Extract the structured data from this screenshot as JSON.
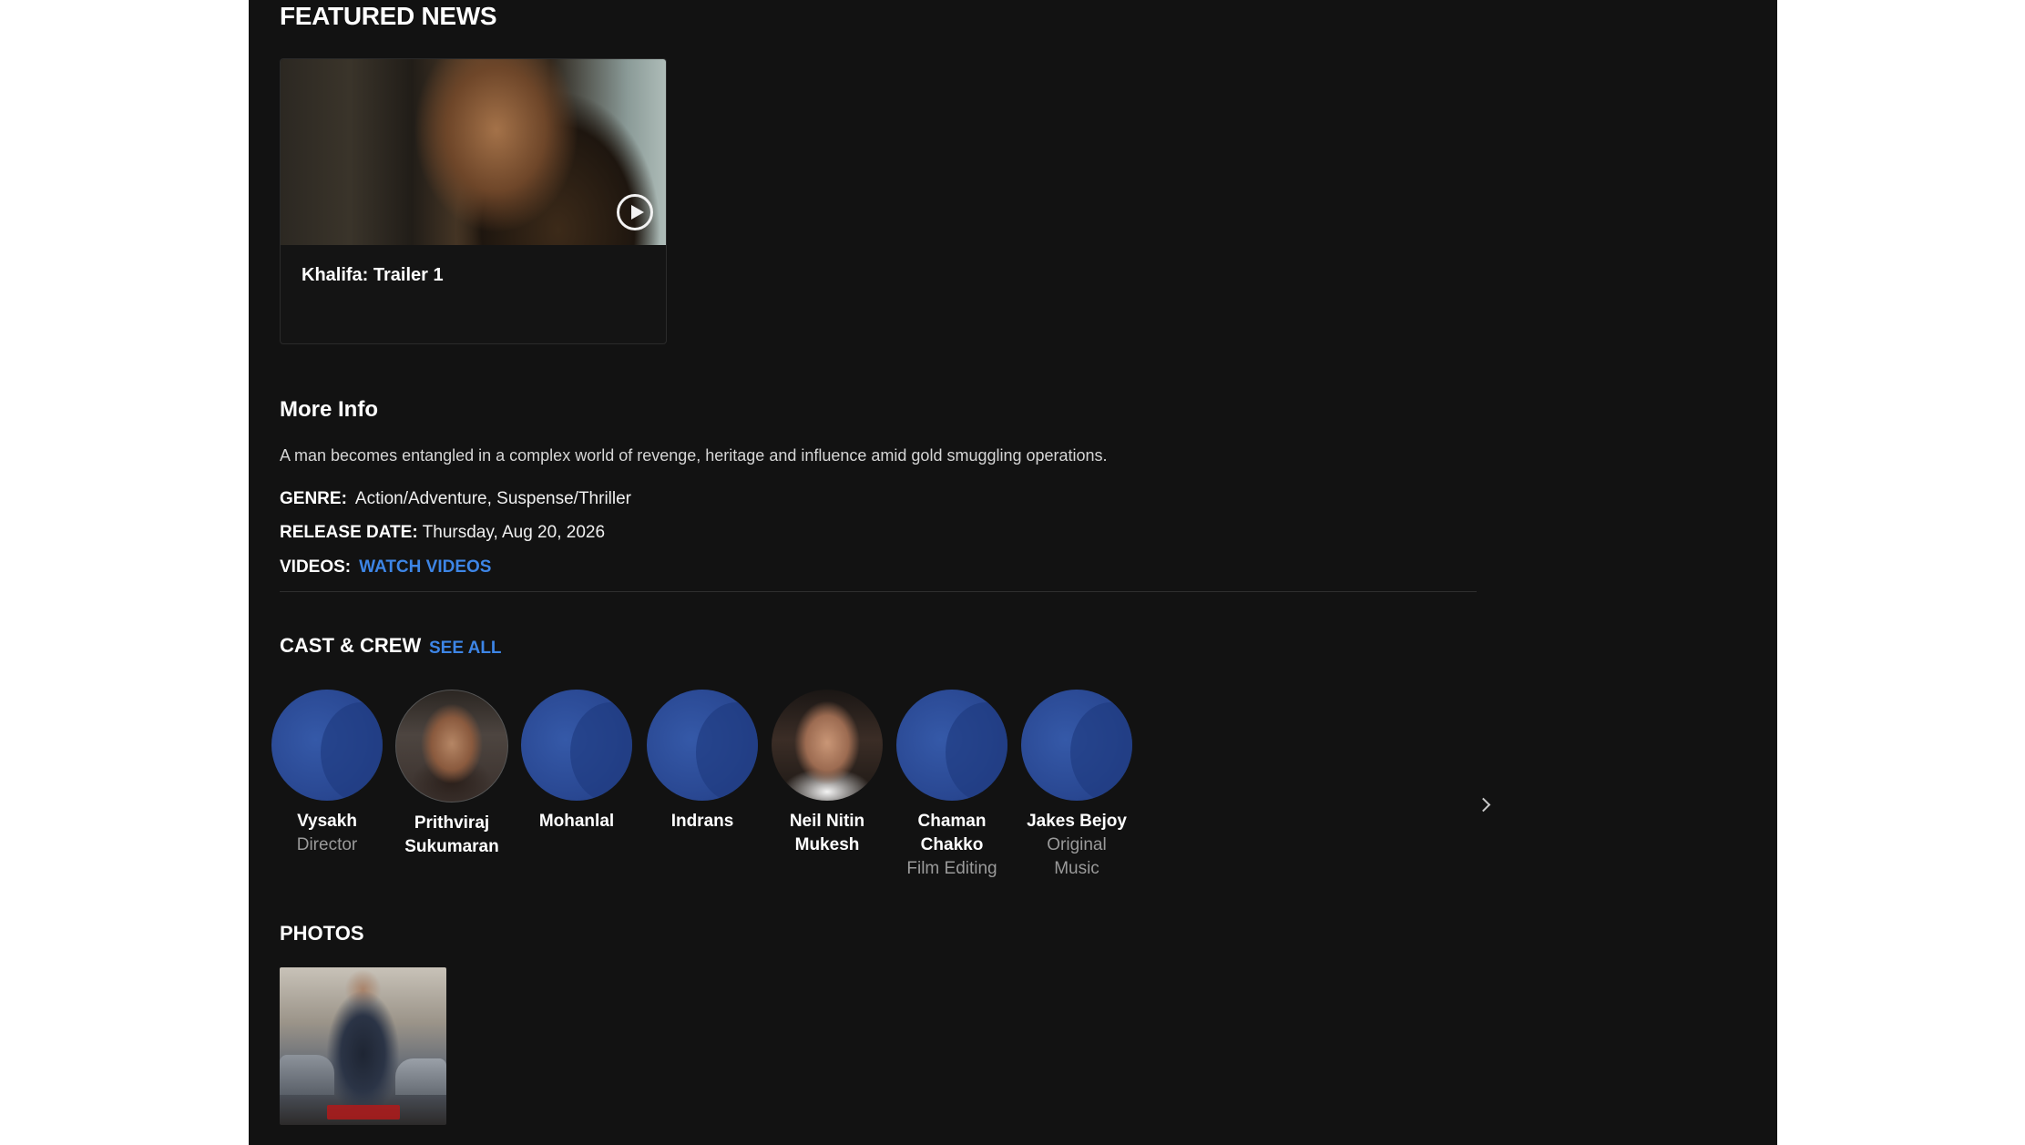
{
  "featured": {
    "title": "FEATURED NEWS",
    "card": {
      "title": "Khalifa: Trailer 1"
    }
  },
  "more_info": {
    "title": "More Info",
    "synopsis": "A man becomes entangled in a complex world of revenge, heritage and influence amid gold smuggling operations.",
    "genre_label": "GENRE:",
    "genre_value": "Action/Adventure,  Suspense/Thriller",
    "release_label": "RELEASE DATE:",
    "release_value": "Thursday, Aug 20, 2026",
    "videos_label": "VIDEOS:",
    "videos_link": "WATCH VIDEOS"
  },
  "cast": {
    "title": "CAST & CREW",
    "see_all": "SEE ALL",
    "members": [
      {
        "name_line1": "Vysakh",
        "name_line2": "",
        "role_line1": "Director",
        "role_line2": ""
      },
      {
        "name_line1": "Prithviraj",
        "name_line2": "Sukumaran",
        "role_line1": "",
        "role_line2": ""
      },
      {
        "name_line1": "Mohanlal",
        "name_line2": "",
        "role_line1": "",
        "role_line2": ""
      },
      {
        "name_line1": "Indrans",
        "name_line2": "",
        "role_line1": "",
        "role_line2": ""
      },
      {
        "name_line1": "Neil Nitin",
        "name_line2": "Mukesh",
        "role_line1": "",
        "role_line2": ""
      },
      {
        "name_line1": "Chaman",
        "name_line2": "Chakko",
        "role_line1": "Film Editing",
        "role_line2": ""
      },
      {
        "name_line1": "Jakes Bejoy",
        "name_line2": "",
        "role_line1": "Original",
        "role_line2": "Music"
      }
    ]
  },
  "photos": {
    "title": "PHOTOS"
  },
  "icons": {
    "play": "play-circle-icon",
    "next": "chevron-right-icon"
  },
  "colors": {
    "panel_bg": "#121212",
    "link": "#3d85e6",
    "muted": "#9a9a9a",
    "placeholder_avatar": "#2b4a95"
  }
}
